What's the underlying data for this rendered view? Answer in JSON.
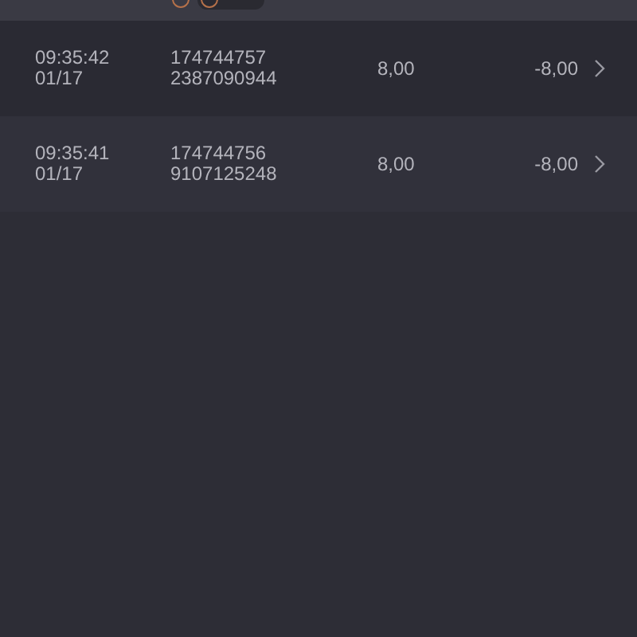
{
  "rows": [
    {
      "time": "09:35:42",
      "date": "01/17",
      "id_line_1": "174744757",
      "id_line_2": "2387090944",
      "amount": "8,00",
      "change": "-8,00"
    },
    {
      "time": "09:35:41",
      "date": "01/17",
      "id_line_1": "174744756",
      "id_line_2": "9107125248",
      "amount": "8,00",
      "change": "-8,00"
    }
  ]
}
